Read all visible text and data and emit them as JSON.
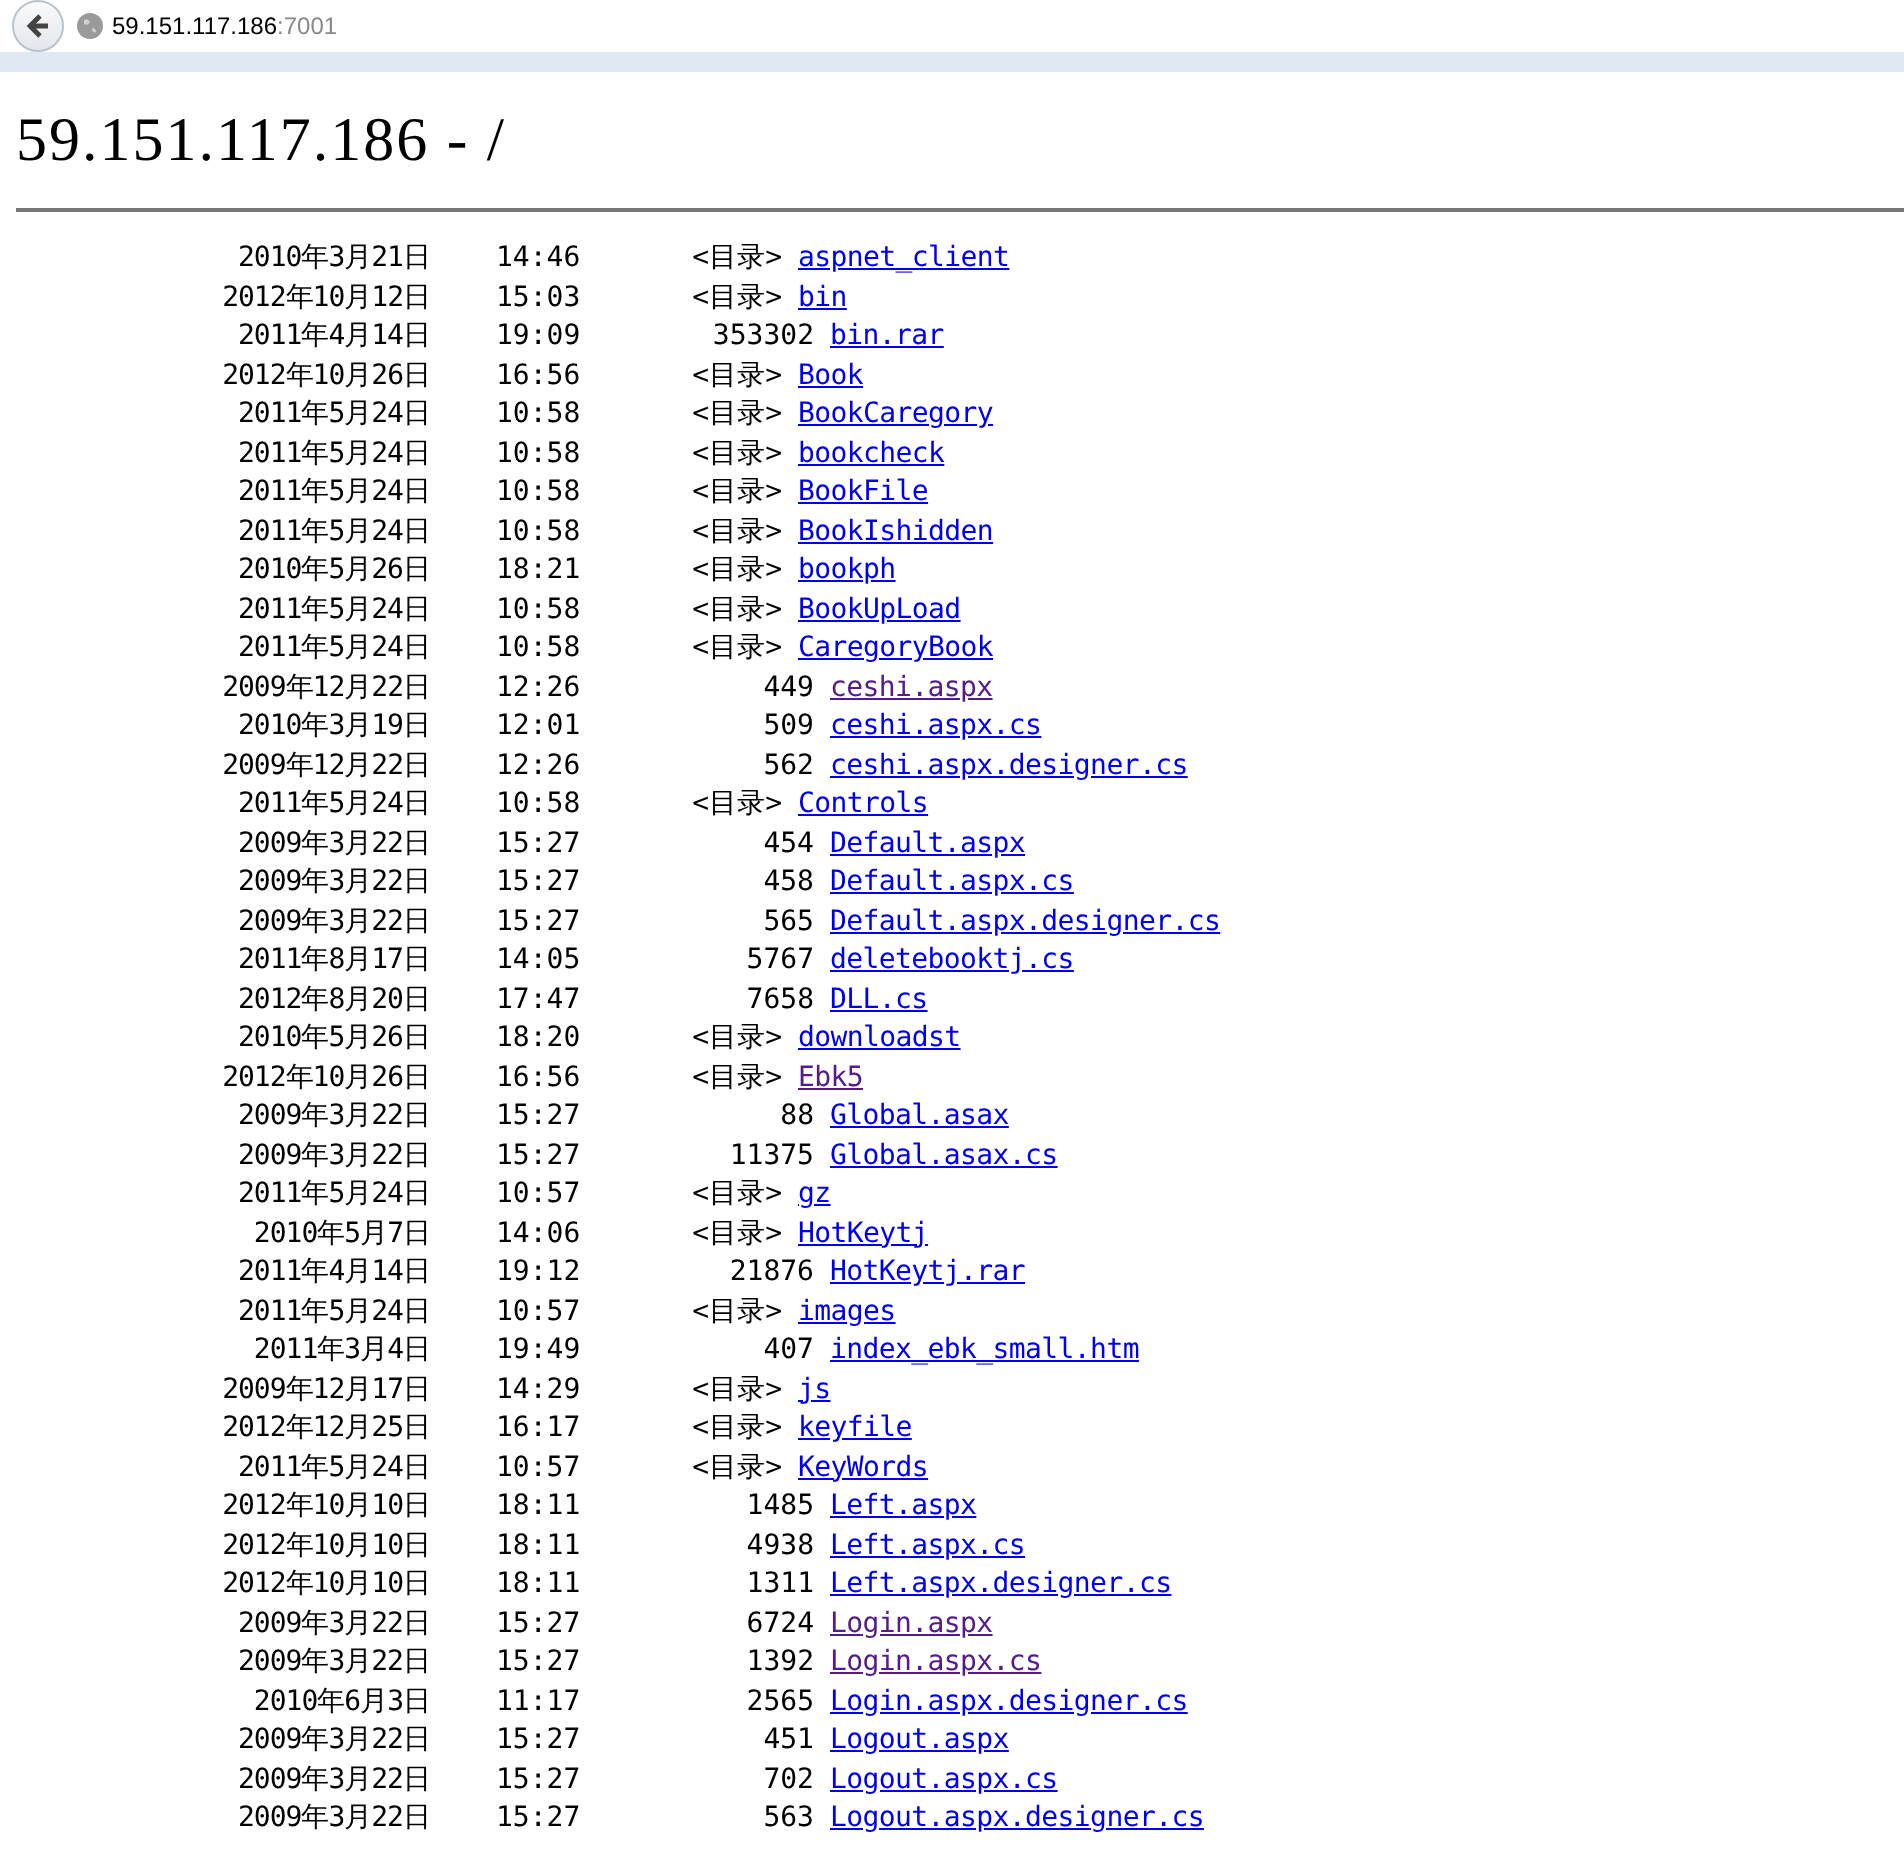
{
  "browser": {
    "host": "59.151.117.186",
    "port": ":7001"
  },
  "heading": "59.151.117.186 - /",
  "rows": [
    {
      "date": "2010年3月21日",
      "time": "14:46",
      "kind": "dir",
      "tag": "<目录>",
      "name": "aspnet_client",
      "visited": false
    },
    {
      "date": "2012年10月12日",
      "time": "15:03",
      "kind": "dir",
      "tag": "<目录>",
      "name": "bin",
      "visited": false
    },
    {
      "date": "2011年4月14日",
      "time": "19:09",
      "kind": "file",
      "size": "353302",
      "name": "bin.rar",
      "visited": false
    },
    {
      "date": "2012年10月26日",
      "time": "16:56",
      "kind": "dir",
      "tag": "<目录>",
      "name": "Book",
      "visited": false
    },
    {
      "date": "2011年5月24日",
      "time": "10:58",
      "kind": "dir",
      "tag": "<目录>",
      "name": "BookCaregory",
      "visited": false
    },
    {
      "date": "2011年5月24日",
      "time": "10:58",
      "kind": "dir",
      "tag": "<目录>",
      "name": "bookcheck",
      "visited": false
    },
    {
      "date": "2011年5月24日",
      "time": "10:58",
      "kind": "dir",
      "tag": "<目录>",
      "name": "BookFile",
      "visited": false
    },
    {
      "date": "2011年5月24日",
      "time": "10:58",
      "kind": "dir",
      "tag": "<目录>",
      "name": "BookIshidden",
      "visited": false
    },
    {
      "date": "2010年5月26日",
      "time": "18:21",
      "kind": "dir",
      "tag": "<目录>",
      "name": "bookph",
      "visited": false
    },
    {
      "date": "2011年5月24日",
      "time": "10:58",
      "kind": "dir",
      "tag": "<目录>",
      "name": "BookUpLoad",
      "visited": false
    },
    {
      "date": "2011年5月24日",
      "time": "10:58",
      "kind": "dir",
      "tag": "<目录>",
      "name": "CaregoryBook",
      "visited": false
    },
    {
      "date": "2009年12月22日",
      "time": "12:26",
      "kind": "file",
      "size": "449",
      "name": "ceshi.aspx",
      "visited": true
    },
    {
      "date": "2010年3月19日",
      "time": "12:01",
      "kind": "file",
      "size": "509",
      "name": "ceshi.aspx.cs",
      "visited": false
    },
    {
      "date": "2009年12月22日",
      "time": "12:26",
      "kind": "file",
      "size": "562",
      "name": "ceshi.aspx.designer.cs",
      "visited": false
    },
    {
      "date": "2011年5月24日",
      "time": "10:58",
      "kind": "dir",
      "tag": "<目录>",
      "name": "Controls",
      "visited": false
    },
    {
      "date": "2009年3月22日",
      "time": "15:27",
      "kind": "file",
      "size": "454",
      "name": "Default.aspx",
      "visited": false
    },
    {
      "date": "2009年3月22日",
      "time": "15:27",
      "kind": "file",
      "size": "458",
      "name": "Default.aspx.cs",
      "visited": false
    },
    {
      "date": "2009年3月22日",
      "time": "15:27",
      "kind": "file",
      "size": "565",
      "name": "Default.aspx.designer.cs",
      "visited": false
    },
    {
      "date": "2011年8月17日",
      "time": "14:05",
      "kind": "file",
      "size": "5767",
      "name": "deletebooktj.cs",
      "visited": false
    },
    {
      "date": "2012年8月20日",
      "time": "17:47",
      "kind": "file",
      "size": "7658",
      "name": "DLL.cs",
      "visited": false
    },
    {
      "date": "2010年5月26日",
      "time": "18:20",
      "kind": "dir",
      "tag": "<目录>",
      "name": "downloadst",
      "visited": false
    },
    {
      "date": "2012年10月26日",
      "time": "16:56",
      "kind": "dir",
      "tag": "<目录>",
      "name": "Ebk5",
      "visited": true
    },
    {
      "date": "2009年3月22日",
      "time": "15:27",
      "kind": "file",
      "size": "88",
      "name": "Global.asax",
      "visited": false
    },
    {
      "date": "2009年3月22日",
      "time": "15:27",
      "kind": "file",
      "size": "11375",
      "name": "Global.asax.cs",
      "visited": false
    },
    {
      "date": "2011年5月24日",
      "time": "10:57",
      "kind": "dir",
      "tag": "<目录>",
      "name": "gz",
      "visited": false
    },
    {
      "date": "2010年5月7日",
      "time": "14:06",
      "kind": "dir",
      "tag": "<目录>",
      "name": "HotKeytj",
      "visited": false
    },
    {
      "date": "2011年4月14日",
      "time": "19:12",
      "kind": "file",
      "size": "21876",
      "name": "HotKeytj.rar",
      "visited": false
    },
    {
      "date": "2011年5月24日",
      "time": "10:57",
      "kind": "dir",
      "tag": "<目录>",
      "name": "images",
      "visited": false
    },
    {
      "date": "2011年3月4日",
      "time": "19:49",
      "kind": "file",
      "size": "407",
      "name": "index_ebk_small.htm",
      "visited": false
    },
    {
      "date": "2009年12月17日",
      "time": "14:29",
      "kind": "dir",
      "tag": "<目录>",
      "name": "js",
      "visited": false
    },
    {
      "date": "2012年12月25日",
      "time": "16:17",
      "kind": "dir",
      "tag": "<目录>",
      "name": "keyfile",
      "visited": false
    },
    {
      "date": "2011年5月24日",
      "time": "10:57",
      "kind": "dir",
      "tag": "<目录>",
      "name": "KeyWords",
      "visited": false
    },
    {
      "date": "2012年10月10日",
      "time": "18:11",
      "kind": "file",
      "size": "1485",
      "name": "Left.aspx",
      "visited": false
    },
    {
      "date": "2012年10月10日",
      "time": "18:11",
      "kind": "file",
      "size": "4938",
      "name": "Left.aspx.cs",
      "visited": false
    },
    {
      "date": "2012年10月10日",
      "time": "18:11",
      "kind": "file",
      "size": "1311",
      "name": "Left.aspx.designer.cs",
      "visited": false
    },
    {
      "date": "2009年3月22日",
      "time": "15:27",
      "kind": "file",
      "size": "6724",
      "name": "Login.aspx",
      "visited": true
    },
    {
      "date": "2009年3月22日",
      "time": "15:27",
      "kind": "file",
      "size": "1392",
      "name": "Login.aspx.cs",
      "visited": true
    },
    {
      "date": "2010年6月3日",
      "time": "11:17",
      "kind": "file",
      "size": "2565",
      "name": "Login.aspx.designer.cs",
      "visited": false
    },
    {
      "date": "2009年3月22日",
      "time": "15:27",
      "kind": "file",
      "size": "451",
      "name": "Logout.aspx",
      "visited": false
    },
    {
      "date": "2009年3月22日",
      "time": "15:27",
      "kind": "file",
      "size": "702",
      "name": "Logout.aspx.cs",
      "visited": false
    },
    {
      "date": "2009年3月22日",
      "time": "15:27",
      "kind": "file",
      "size": "563",
      "name": "Logout.aspx.designer.cs",
      "visited": false
    }
  ]
}
